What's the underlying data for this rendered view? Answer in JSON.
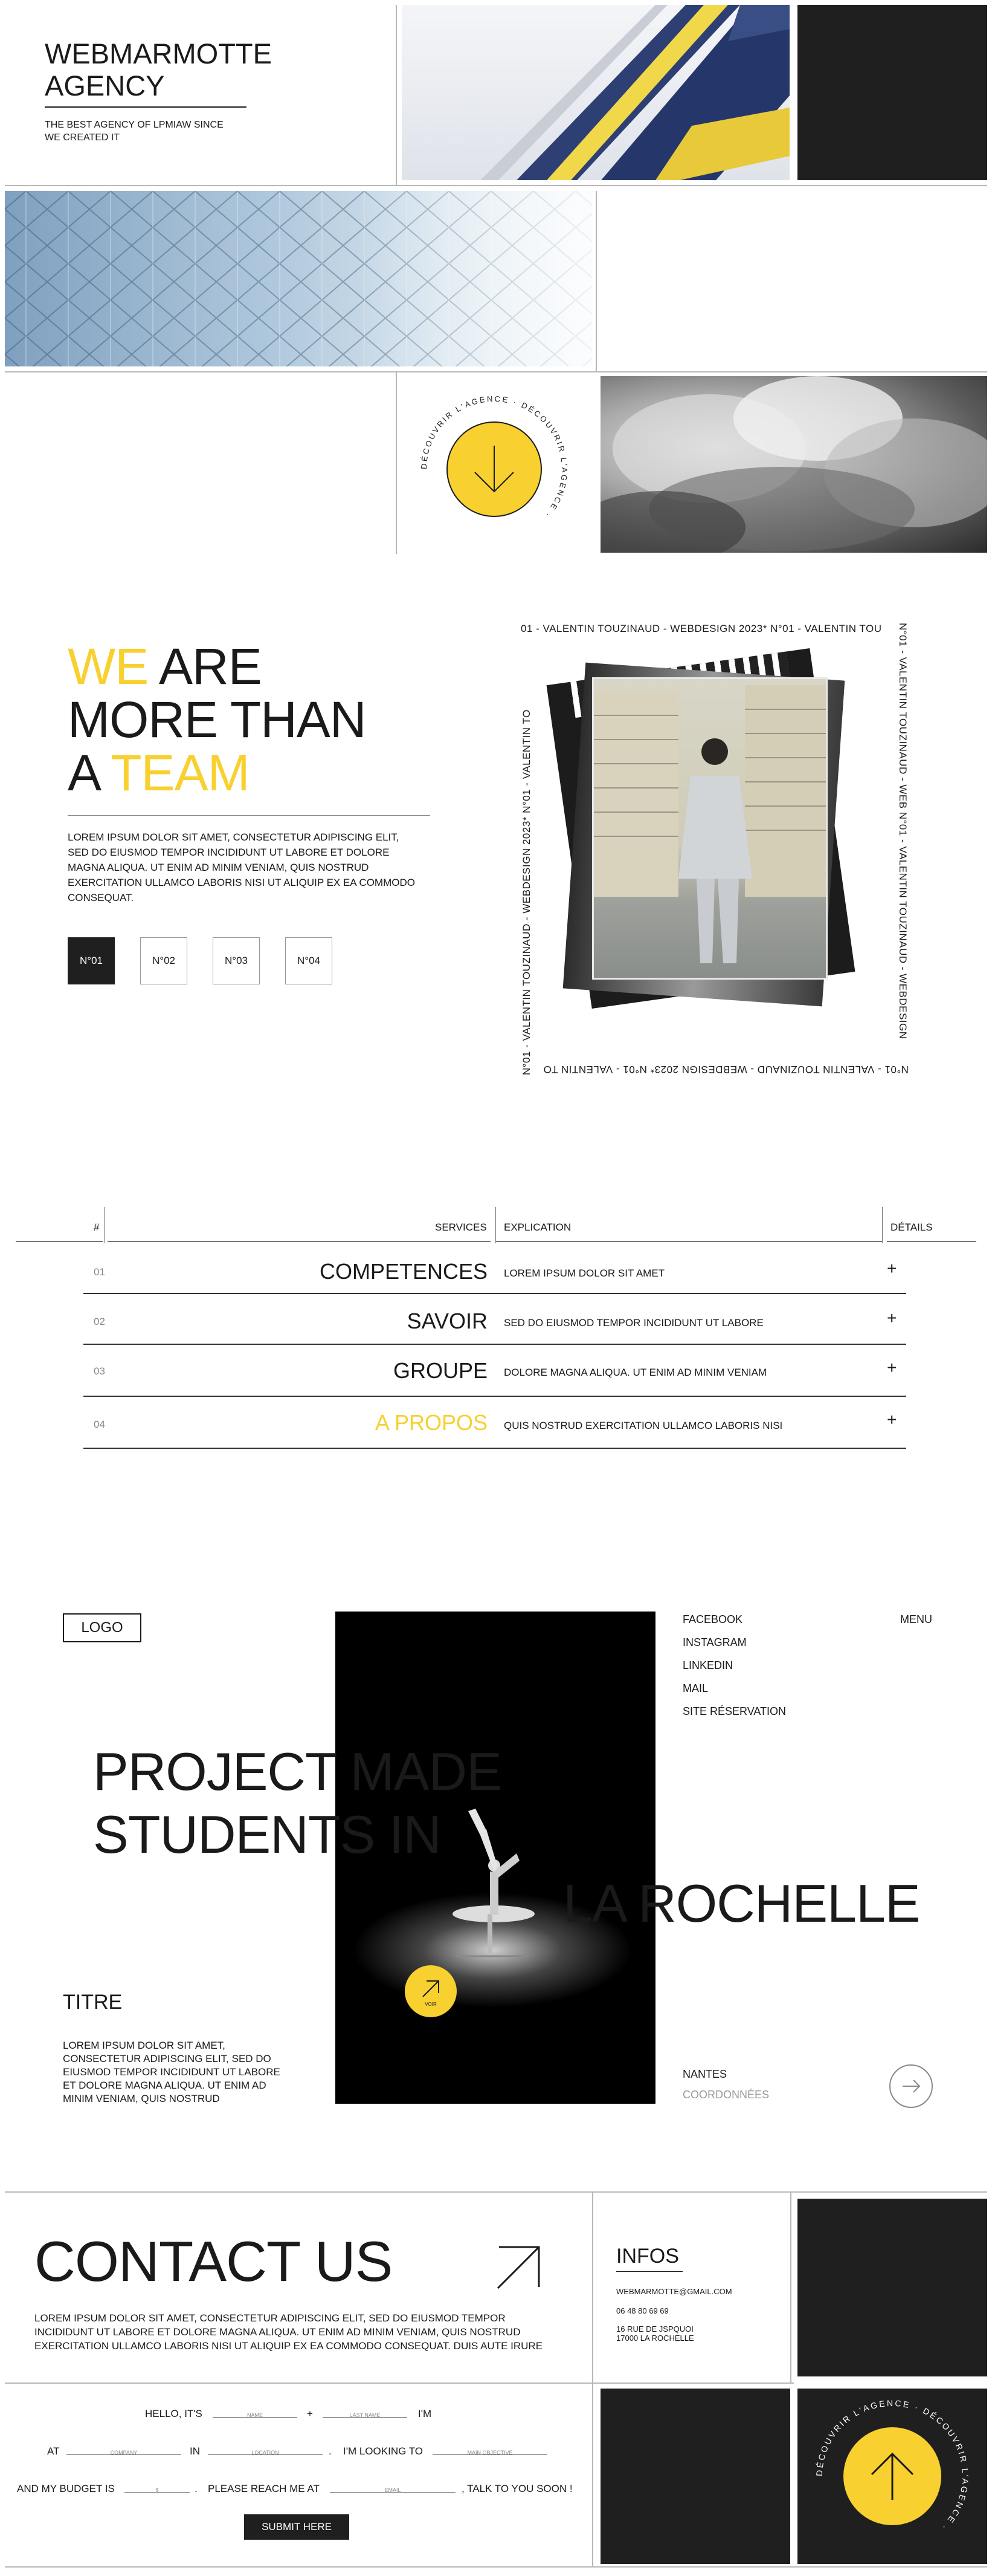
{
  "hero": {
    "title_line1": "WEBMARMOTTE",
    "title_line2": "AGENCY",
    "subtitle_line1": "THE BEST AGENCY OF LPMIAW SINCE",
    "subtitle_line2": "WE CREATED IT"
  },
  "discover_badge": {
    "ring_text": "DÉCOUVRIR L'AGENCE · DÉCOUVRIR L'AGENCE · "
  },
  "team": {
    "title_w1": "WE",
    "title_w2": "ARE",
    "title_line2": "MORE THAN",
    "title_w3": "A",
    "title_w4": "TEAM",
    "paragraph": "LOREM IPSUM DOLOR SIT AMET, CONSECTETUR ADIPISCING ELIT, SED DO EIUSMOD TEMPOR INCIDIDUNT UT LABORE ET DOLORE MAGNA ALIQUA. UT ENIM AD MINIM VENIAM, QUIS NOSTRUD EXERCITATION ULLAMCO LABORIS NISI UT ALIQUIP EX EA COMMODO CONSEQUAT.",
    "pager": [
      "N°01",
      "N°02",
      "N°03",
      "N°04"
    ],
    "ticker": {
      "top": "01  -  VALENTIN TOUZINAUD  -  WEBDESIGN 2023*   N°01  -  VALENTIN TOU",
      "right": "N°01  -  VALENTIN TOUZINAUD  -  WEB  N°01  -  VALENTIN TOUZINAUD  -  WEBDESIGN",
      "bottom": "N°01  -  VALENTIN TOUZINAUD  -  WEBDESIGN 2023*   N°01  -  VALENTIN TO",
      "left": "N°01  -  VALENTIN TOUZINAUD  -  WEBDESIGN 2023*  N°01  -  VALENTIN TO"
    }
  },
  "services_table": {
    "headers": {
      "num": "#",
      "services": "SERVICES",
      "explication": "EXPLICATION",
      "details": "DÉTAILS"
    },
    "rows": [
      {
        "num": "01",
        "service": "COMPETENCES",
        "explication": "LOREM IPSUM DOLOR SIT AMET",
        "plus": "+"
      },
      {
        "num": "02",
        "service": "SAVOIR",
        "explication": "SED DO EIUSMOD TEMPOR INCIDIDUNT UT LABORE",
        "plus": "+"
      },
      {
        "num": "03",
        "service": "GROUPE",
        "explication": "DOLORE MAGNA ALIQUA. UT ENIM AD MINIM VENIAM",
        "plus": "+"
      },
      {
        "num": "04",
        "service": "A PROPOS",
        "explication": "QUIS NOSTRUD EXERCITATION ULLAMCO LABORIS NISI",
        "plus": "+"
      }
    ]
  },
  "project": {
    "logo": "LOGO",
    "links": [
      "FACEBOOK",
      "INSTAGRAM",
      "LINKEDIN",
      "MAIL",
      "SITE RÉSERVATION"
    ],
    "menu": "MENU",
    "headline_line1": "PROJECT MADE",
    "headline_line2": "STUDENTS IN",
    "headline_line3": "LA ROCHELLE",
    "subtitle": "TITRE",
    "paragraph": "LOREM IPSUM DOLOR SIT AMET, CONSECTETUR ADIPISCING ELIT, SED DO EIUSMOD TEMPOR INCIDIDUNT UT LABORE ET DOLORE MAGNA ALIQUA. UT ENIM AD MINIM VENIAM, QUIS NOSTRUD",
    "voir": "VOIR",
    "city": "NANTES",
    "coords": "COORDONNÉES"
  },
  "contact": {
    "title": "CONTACT US",
    "paragraph": "LOREM IPSUM DOLOR SIT AMET, CONSECTETUR ADIPISCING ELIT, SED DO EIUSMOD TEMPOR INCIDIDUNT UT LABORE ET DOLORE MAGNA ALIQUA. UT ENIM AD MINIM VENIAM, QUIS NOSTRUD EXERCITATION ULLAMCO LABORIS NISI UT ALIQUIP EX EA COMMODO CONSEQUAT. DUIS AUTE IRURE",
    "infos_title": "INFOS",
    "email": "WEBMARMOTTE@GMAIL.COM",
    "phone": "06 48 80 69 69",
    "address_line1": "16 RUE DE JSPQUOI",
    "address_line2": "17000 LA ROCHELLE",
    "form": {
      "hello": "HELLO, IT'S",
      "plus": "+",
      "im": "I'M",
      "at": "AT",
      "in": "IN",
      "dot1": ".",
      "looking": "I'M LOOKING TO",
      "budget": "AND MY BUDGET IS",
      "dot2": ".",
      "reach": "PLEASE REACH ME AT",
      "talk": ", TALK TO YOU SOON !",
      "ph_name": "NAME",
      "ph_last": "LAST NAME",
      "ph_company": "COMPANY",
      "ph_location": "LOCATION",
      "ph_objective": "MAIN OBJECTIVE",
      "ph_budget": "$",
      "ph_email": "EMAIL",
      "submit": "SUBMIT HERE"
    }
  },
  "colors": {
    "accent": "#f8d02f",
    "dark": "#1f1f1f",
    "line": "#b8b8b8"
  }
}
